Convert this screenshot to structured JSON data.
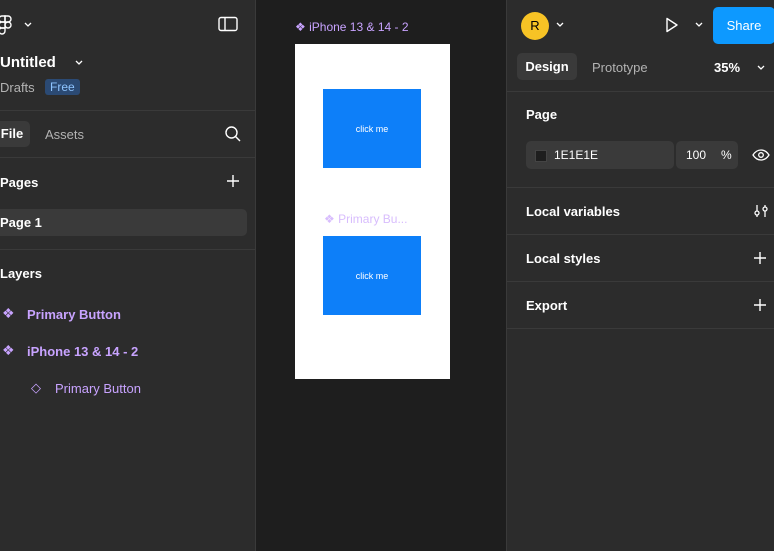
{
  "left": {
    "file_name": "Untitled",
    "location": "Drafts",
    "plan_badge": "Free",
    "tabs": {
      "file": "File",
      "assets": "Assets"
    },
    "pages_heading": "Pages",
    "page_item": "Page 1",
    "layers_heading": "Layers",
    "layers": [
      {
        "label": "Primary Button",
        "icon": "component-icon"
      },
      {
        "label": "iPhone 13 & 14 - 2",
        "icon": "component-icon"
      },
      {
        "label": "Primary Button",
        "icon": "instance-icon"
      }
    ]
  },
  "canvas": {
    "frame_label": "iPhone 13 & 14 - 2",
    "component_label": "Primary Bu...",
    "button1_text": "click me",
    "button2_text": "click me",
    "button_color": "#0d7ff9"
  },
  "right": {
    "avatar_initial": "R",
    "share_label": "Share",
    "tabs": {
      "design": "Design",
      "prototype": "Prototype"
    },
    "zoom": "35%",
    "page_heading": "Page",
    "bg_hex": "1E1E1E",
    "bg_opacity": "100",
    "opacity_unit": "%",
    "sections": {
      "local_variables": "Local variables",
      "local_styles": "Local styles",
      "export": "Export"
    }
  },
  "colors": {
    "accent": "#0d99ff",
    "component": "#c8a3ff",
    "avatar": "#f7c325"
  }
}
